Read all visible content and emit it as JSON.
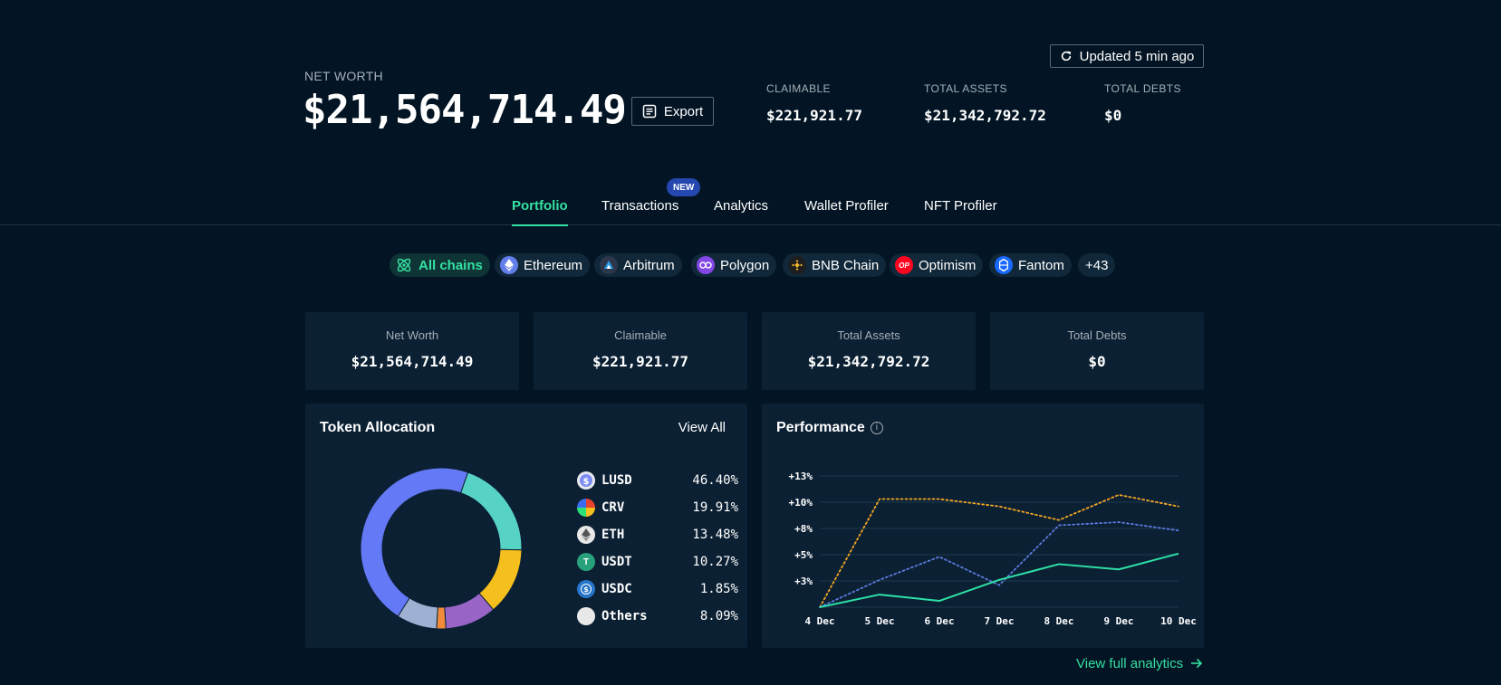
{
  "header": {
    "net_worth_label": "NET WORTH",
    "net_worth_value": "$21,564,714.49",
    "export_label": "Export",
    "updated_label": "Updated 5 min ago",
    "stats": [
      {
        "label": "CLAIMABLE",
        "value": "$221,921.77"
      },
      {
        "label": "TOTAL ASSETS",
        "value": "$21,342,792.72"
      },
      {
        "label": "TOTAL DEBTS",
        "value": "$0"
      }
    ]
  },
  "tabs": {
    "items": [
      "Portfolio",
      "Transactions",
      "Analytics",
      "Wallet Profiler",
      "NFT Profiler"
    ],
    "active": "Portfolio",
    "new_badge": "NEW"
  },
  "chains": {
    "items": [
      {
        "label": "All chains",
        "icon": "all-chains-icon",
        "color": "#35e0a1"
      },
      {
        "label": "Ethereum",
        "icon": "ethereum-icon",
        "color": "#627eea"
      },
      {
        "label": "Arbitrum",
        "icon": "arbitrum-icon",
        "color": "#2d374b"
      },
      {
        "label": "Polygon",
        "icon": "polygon-icon",
        "color": "#8247e5"
      },
      {
        "label": "BNB Chain",
        "icon": "bnb-icon",
        "color": "#f3ba2f"
      },
      {
        "label": "Optimism",
        "icon": "optimism-icon",
        "color": "#ff0420"
      },
      {
        "label": "Fantom",
        "icon": "fantom-icon",
        "color": "#1969ff"
      }
    ],
    "more_label": "+43"
  },
  "cards": [
    {
      "label": "Net Worth",
      "value": "$21,564,714.49"
    },
    {
      "label": "Claimable",
      "value": "$221,921.77"
    },
    {
      "label": "Total Assets",
      "value": "$21,342,792.72"
    },
    {
      "label": "Total Debts",
      "value": "$0"
    }
  ],
  "allocation": {
    "title": "Token Allocation",
    "view_all": "View All",
    "tokens": [
      {
        "symbol": "LUSD",
        "percent": "46.40%",
        "value": 46.4,
        "color": "#6479f5",
        "icon_color": "#7b8cf0"
      },
      {
        "symbol": "CRV",
        "percent": "19.91%",
        "value": 19.91,
        "color": "#57d3c6",
        "icon_color": "#e8432f"
      },
      {
        "symbol": "ETH",
        "percent": "13.48%",
        "value": 13.48,
        "color": "#f5bf1d",
        "icon_color": "#e8e8e8"
      },
      {
        "symbol": "USDT",
        "percent": "10.27%",
        "value": 10.27,
        "color": "#9865c6",
        "icon_color": "#26a17b"
      },
      {
        "symbol": "USDC",
        "percent": "1.85%",
        "value": 1.85,
        "color": "#f08c3c",
        "icon_color": "#2775ca"
      },
      {
        "symbol": "Others",
        "percent": "8.09%",
        "value": 8.09,
        "color": "#9fb1d2",
        "icon_color": "#e8e8e8"
      }
    ]
  },
  "performance": {
    "title": "Performance",
    "view_full": "View full analytics",
    "chart_data": {
      "type": "line",
      "x": [
        "4 Dec",
        "5 Dec",
        "6 Dec",
        "7 Dec",
        "8 Dec",
        "9 Dec",
        "10 Dec"
      ],
      "y_ticks": [
        "+13%",
        "+10%",
        "+8%",
        "+5%",
        "+3%"
      ],
      "y_tick_values": [
        12.5,
        10,
        7.5,
        5,
        2.5
      ],
      "ylim": [
        0,
        12.5
      ],
      "grid": true,
      "series": [
        {
          "values": [
            0,
            10.3,
            10.3,
            9.6,
            8.3,
            10.7,
            9.6
          ],
          "color": "#f5a623",
          "style": "dotted"
        },
        {
          "values": [
            0,
            2.6,
            4.8,
            2.1,
            7.8,
            8.1,
            7.3
          ],
          "color": "#5b7be0",
          "style": "dotted"
        },
        {
          "values": [
            0,
            1.2,
            0.6,
            2.6,
            4.1,
            3.6,
            5.1
          ],
          "color": "#2de0a6",
          "style": "solid"
        }
      ]
    }
  }
}
